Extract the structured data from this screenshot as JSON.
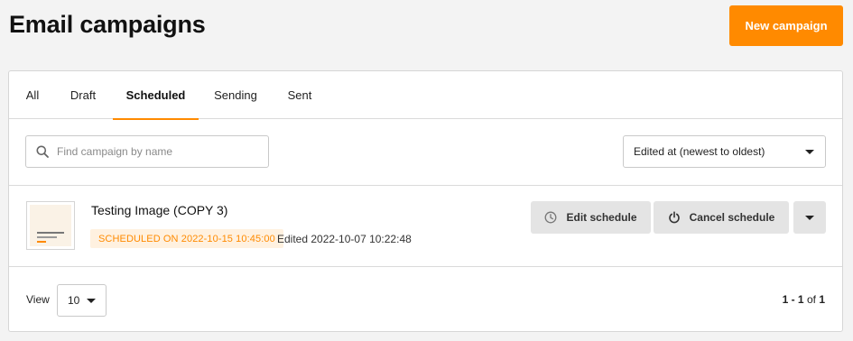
{
  "header": {
    "title": "Email campaigns",
    "new_button": "New campaign"
  },
  "tabs": [
    {
      "label": "All"
    },
    {
      "label": "Draft"
    },
    {
      "label": "Scheduled"
    },
    {
      "label": "Sending"
    },
    {
      "label": "Sent"
    }
  ],
  "active_tab": "Scheduled",
  "search": {
    "placeholder": "Find campaign by name",
    "value": ""
  },
  "sort": {
    "selected": "Edited at (newest to oldest)"
  },
  "campaigns": [
    {
      "name": "Testing Image (COPY 3)",
      "status": "SCHEDULED ON 2022-10-15 10:45:00",
      "edited": "Edited 2022-10-07 10:22:48",
      "actions": {
        "edit_schedule": "Edit schedule",
        "cancel_schedule": "Cancel schedule"
      }
    }
  ],
  "footer": {
    "view_label": "View",
    "view_value": "10",
    "range_start": "1",
    "range_end": "1",
    "range_sep": " - ",
    "of_label": "of",
    "total": "1"
  },
  "colors": {
    "accent": "#ff8a00",
    "badge_bg": "#fff1e0",
    "button_bg": "#e4e4e4"
  },
  "icons": {
    "search": "search-icon",
    "clock": "clock-icon",
    "power": "power-icon",
    "caret": "caret-down-icon"
  }
}
